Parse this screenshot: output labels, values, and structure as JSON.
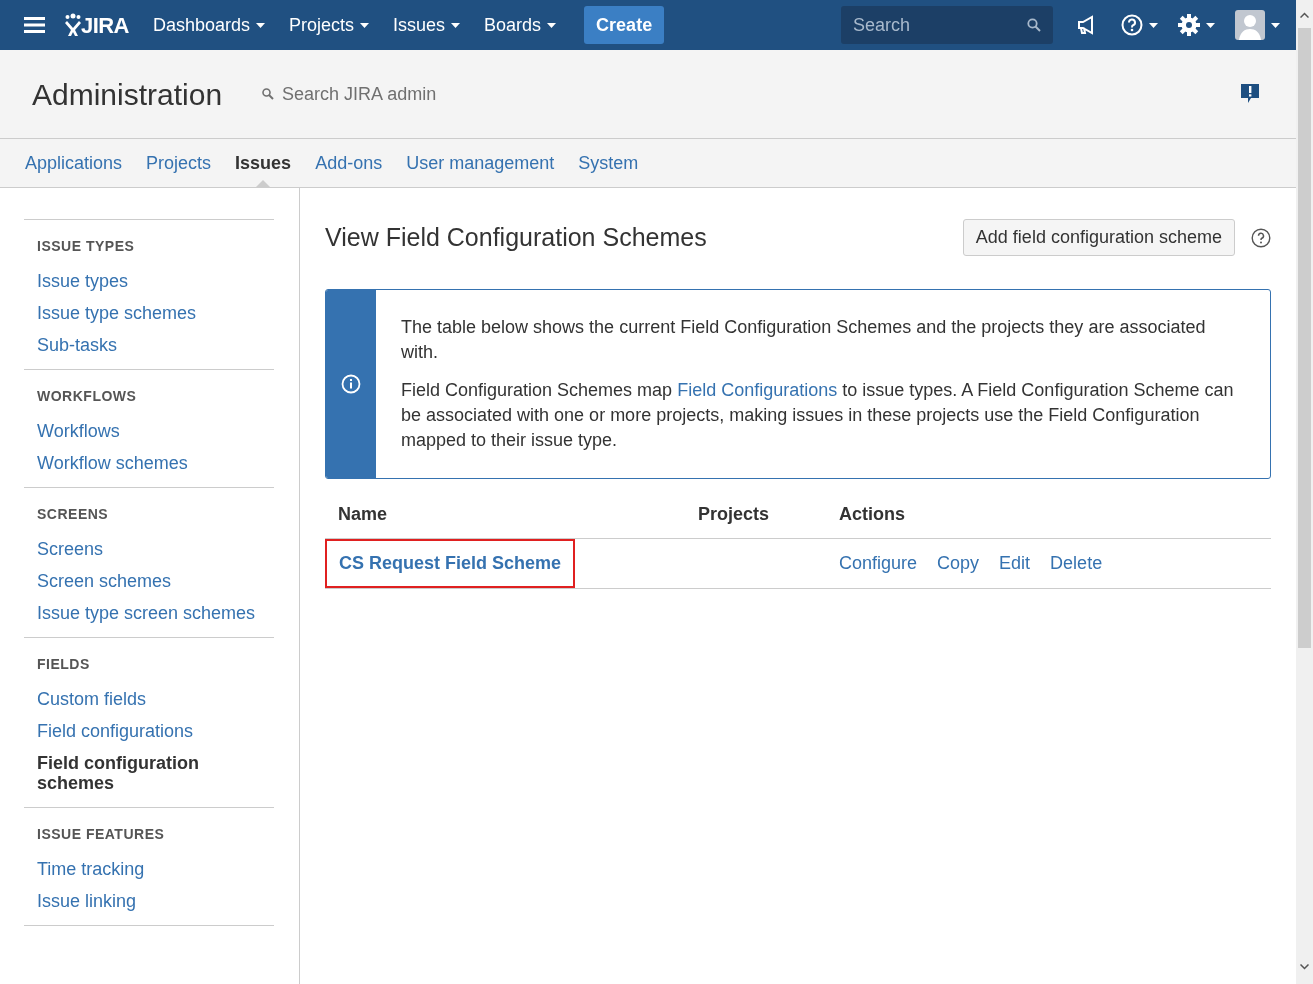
{
  "topbar": {
    "logo": "JIRA",
    "menus": [
      {
        "label": "Dashboards"
      },
      {
        "label": "Projects"
      },
      {
        "label": "Issues"
      },
      {
        "label": "Boards"
      }
    ],
    "create": "Create",
    "search": {
      "placeholder": "Search"
    }
  },
  "admin": {
    "title": "Administration",
    "search": {
      "placeholder": "Search JIRA admin"
    }
  },
  "tabs": [
    {
      "label": "Applications",
      "selected": false
    },
    {
      "label": "Projects",
      "selected": false
    },
    {
      "label": "Issues",
      "selected": true
    },
    {
      "label": "Add-ons",
      "selected": false
    },
    {
      "label": "User management",
      "selected": false
    },
    {
      "label": "System",
      "selected": false
    }
  ],
  "sidebar": [
    {
      "heading": "ISSUE TYPES",
      "items": [
        {
          "label": "Issue types",
          "selected": false
        },
        {
          "label": "Issue type schemes",
          "selected": false
        },
        {
          "label": "Sub-tasks",
          "selected": false
        }
      ]
    },
    {
      "heading": "WORKFLOWS",
      "items": [
        {
          "label": "Workflows",
          "selected": false
        },
        {
          "label": "Workflow schemes",
          "selected": false
        }
      ]
    },
    {
      "heading": "SCREENS",
      "items": [
        {
          "label": "Screens",
          "selected": false
        },
        {
          "label": "Screen schemes",
          "selected": false
        },
        {
          "label": "Issue type screen schemes",
          "selected": false
        }
      ]
    },
    {
      "heading": "FIELDS",
      "items": [
        {
          "label": "Custom fields",
          "selected": false
        },
        {
          "label": "Field configurations",
          "selected": false
        },
        {
          "label": "Field configuration schemes",
          "selected": true
        }
      ]
    },
    {
      "heading": "ISSUE FEATURES",
      "items": [
        {
          "label": "Time tracking",
          "selected": false
        },
        {
          "label": "Issue linking",
          "selected": false
        }
      ]
    }
  ],
  "page": {
    "title": "View Field Configuration Schemes",
    "add_button": "Add field configuration scheme",
    "info": {
      "paragraph_1": "The table below shows the current Field Configuration Schemes and the projects they are associated with.",
      "paragraph_2": {
        "before": "Field Configuration Schemes map",
        "link": "Field Configurations",
        "after": "to issue types. A Field Configuration Scheme can be associated with one or more projects, making issues in these projects use the Field Configuration mapped to their issue type."
      }
    },
    "table": {
      "columns": [
        "Name",
        "Projects",
        "Actions"
      ],
      "rows": [
        {
          "name": "CS Request Field Scheme",
          "highlighted": true,
          "actions": [
            "Configure",
            "Copy",
            "Edit",
            "Delete"
          ]
        }
      ]
    }
  }
}
